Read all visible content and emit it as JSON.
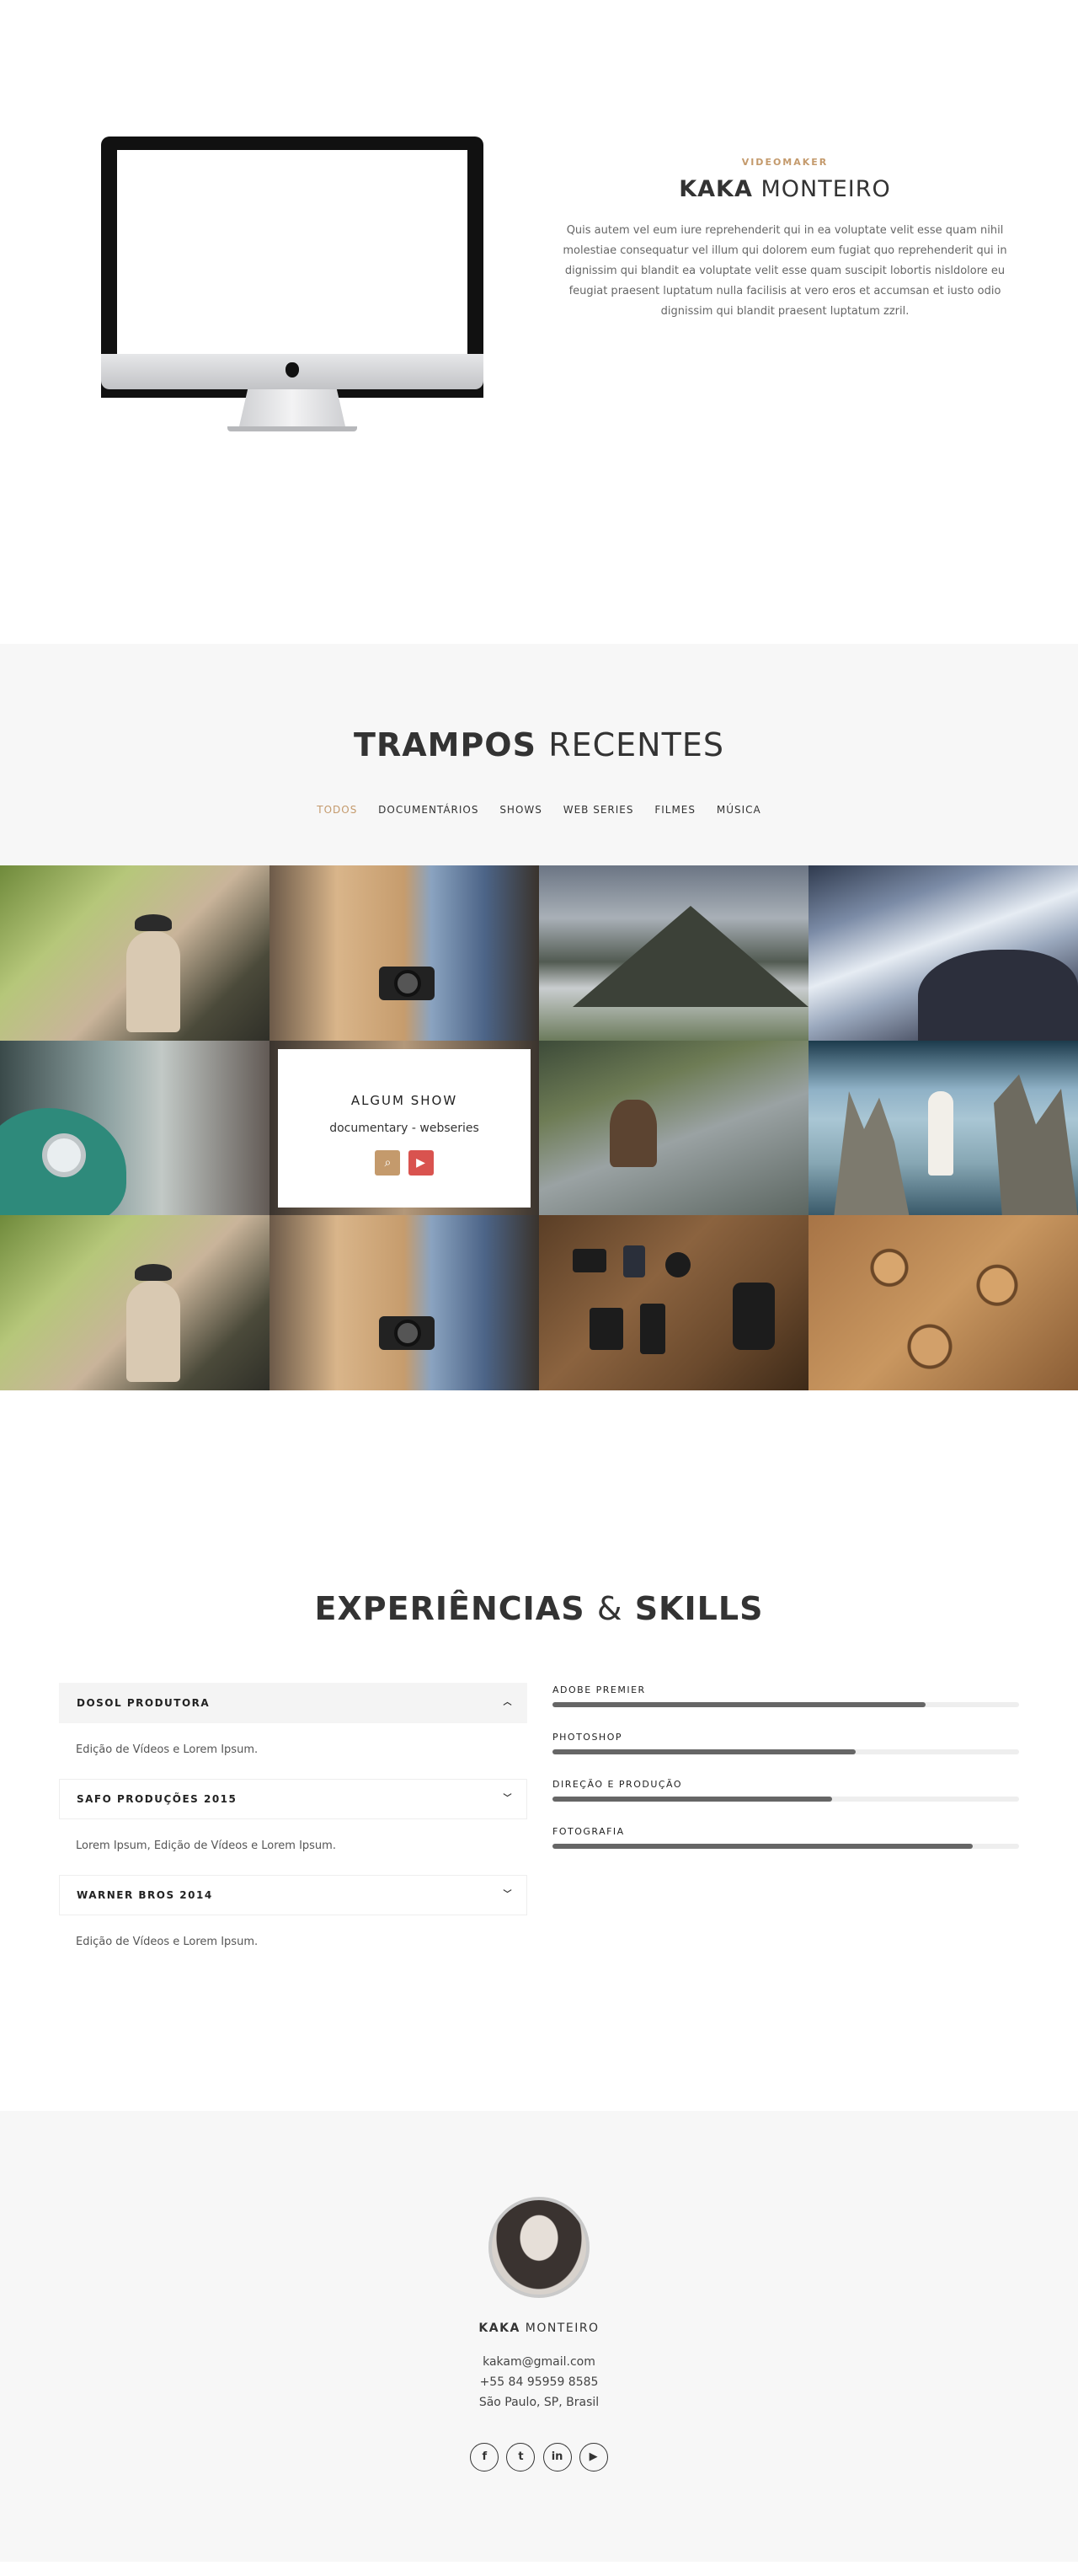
{
  "intro": {
    "role": "VIDEOMAKER",
    "name_bold": "KAKA",
    "name_light": "MONTEIRO",
    "text": "Quis autem vel eum iure reprehenderit qui in ea voluptate velit esse quam nihil molestiae consequatur vel illum qui dolorem eum fugiat quo reprehenderit qui in dignissim qui blandit ea voluptate velit esse quam suscipit lobortis nisldolore eu feugiat praesent luptatum nulla facilisis at vero eros et accumsan et iusto odio dignissim qui blandit praesent luptatum zzril."
  },
  "portfolio": {
    "title_bold": "TRAMPOS",
    "title_light": "RECENTES",
    "filters": [
      "TODOS",
      "DOCUMENTÁRIOS",
      "SHOWS",
      "WEB SERIES",
      "FILMES",
      "MÚSICA"
    ],
    "active_filter": "TODOS",
    "active_card": {
      "title": "ALGUM SHOW",
      "subtitle": "documentary - webseries",
      "search_icon": "search-icon",
      "youtube_icon": "youtube-icon"
    }
  },
  "skills": {
    "title_bold_1": "EXPERIÊNCIAS",
    "title_amp": "&",
    "title_bold_2": "SKILLS",
    "experiences": [
      {
        "title": "DOSOL PRODUTORA",
        "text": "Edição de Vídeos e Lorem Ipsum.",
        "open": true
      },
      {
        "title": "SAFO PRODUÇÕES 2015",
        "text": "Lorem Ipsum, Edição de Vídeos e Lorem Ipsum.",
        "open": false
      },
      {
        "title": "WARNER BROS 2014",
        "text": "Edição de Vídeos e Lorem Ipsum.",
        "open": false
      }
    ],
    "bars": [
      {
        "label": "ADOBE PREMIER",
        "level": 0.8
      },
      {
        "label": "PHOTOSHOP",
        "level": 0.65
      },
      {
        "label": "DIREÇÃO E PRODUÇÃO",
        "level": 0.6
      },
      {
        "label": "FOTOGRAFIA",
        "level": 0.9
      }
    ]
  },
  "footer": {
    "name_bold": "KAKA",
    "name_light": "MONTEIRO",
    "email": "kakam@gmail.com",
    "phone": "+55 84 95959 8585",
    "location": "São Paulo, SP, Brasil",
    "socials": [
      {
        "name": "facebook-icon",
        "glyph": "f"
      },
      {
        "name": "twitter-icon",
        "glyph": "t"
      },
      {
        "name": "linkedin-icon",
        "glyph": "in"
      },
      {
        "name": "youtube-icon",
        "glyph": "▶"
      }
    ]
  },
  "colors": {
    "accent": "#c49a6c",
    "youtube": "#d9534f",
    "section_bg": "#f7f7f7",
    "bar_fill": "#666666"
  }
}
